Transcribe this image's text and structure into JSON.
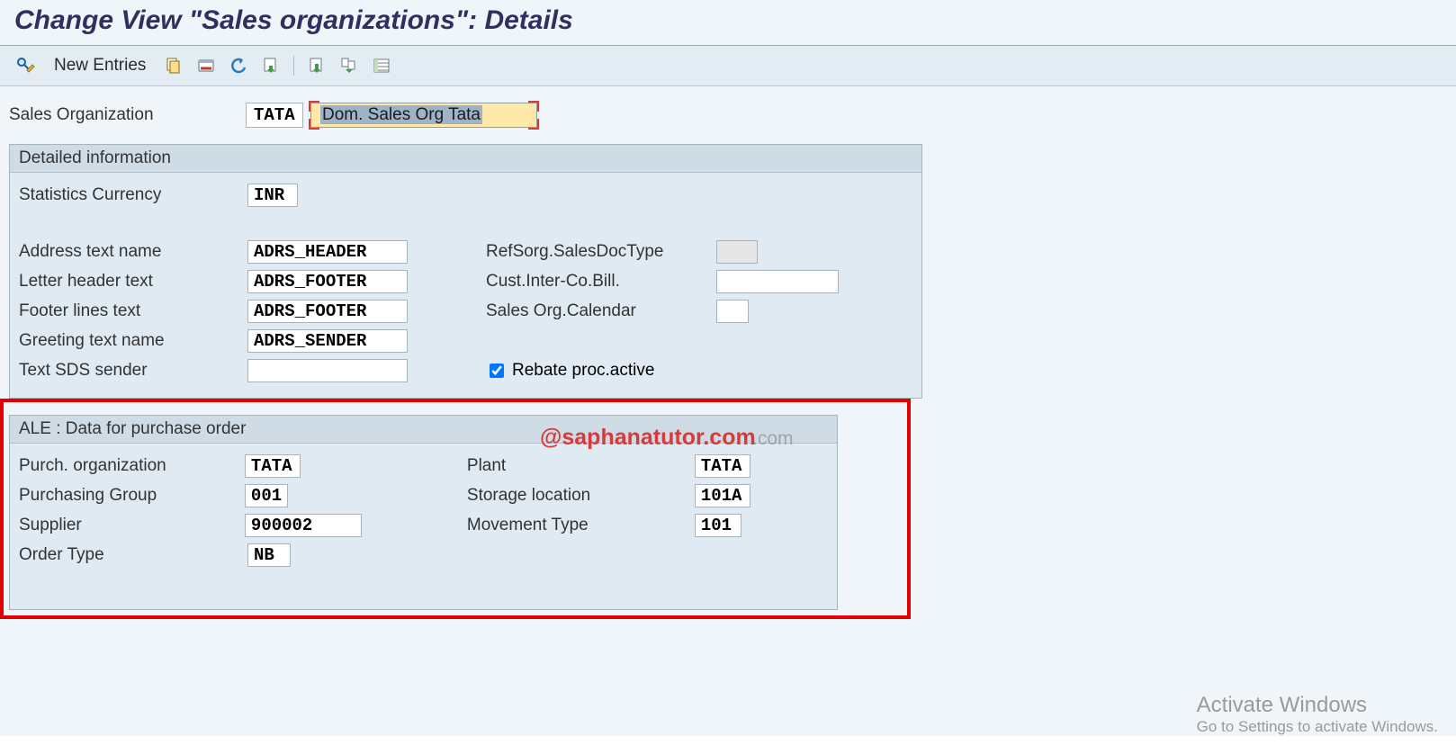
{
  "title": "Change View \"Sales organizations\": Details",
  "toolbar": {
    "new_entries": "New Entries"
  },
  "org": {
    "label": "Sales Organization",
    "code": "TATA",
    "desc": "Dom. Sales Org Tata"
  },
  "group1": {
    "title": "Detailed information",
    "stats_currency_label": "Statistics Currency",
    "stats_currency": "INR",
    "addr_label": "Address text name",
    "addr_value": "ADRS_HEADER",
    "letter_label": "Letter header text",
    "letter_value": "ADRS_FOOTER",
    "footer_label": "Footer lines text",
    "footer_value": "ADRS_FOOTER",
    "greet_label": "Greeting text name",
    "greet_value": "ADRS_SENDER",
    "sds_label": "Text SDS sender",
    "sds_value": "",
    "ref_label": "RefSorg.SalesDocType",
    "ref_value": "",
    "cust_label": "Cust.Inter-Co.Bill.",
    "cust_value": "",
    "cal_label": "Sales Org.Calendar",
    "cal_value": "",
    "rebate_label": "Rebate proc.active",
    "rebate_checked": true
  },
  "group2": {
    "title": "ALE : Data for purchase order",
    "purch_org_label": "Purch. organization",
    "purch_org": "TATA",
    "purch_grp_label": "Purchasing Group",
    "purch_grp": "001",
    "supplier_label": "Supplier",
    "supplier": "900002",
    "order_type_label": "Order Type",
    "order_type": "NB",
    "plant_label": "Plant",
    "plant": "TATA",
    "storage_label": "Storage location",
    "storage": "101A",
    "mvt_label": "Movement Type",
    "mvt": "101"
  },
  "watermark1": "@saphanatutor.com",
  "watermark2": ".com",
  "activate": {
    "title": "Activate Windows",
    "sub": "Go to Settings to activate Windows."
  }
}
